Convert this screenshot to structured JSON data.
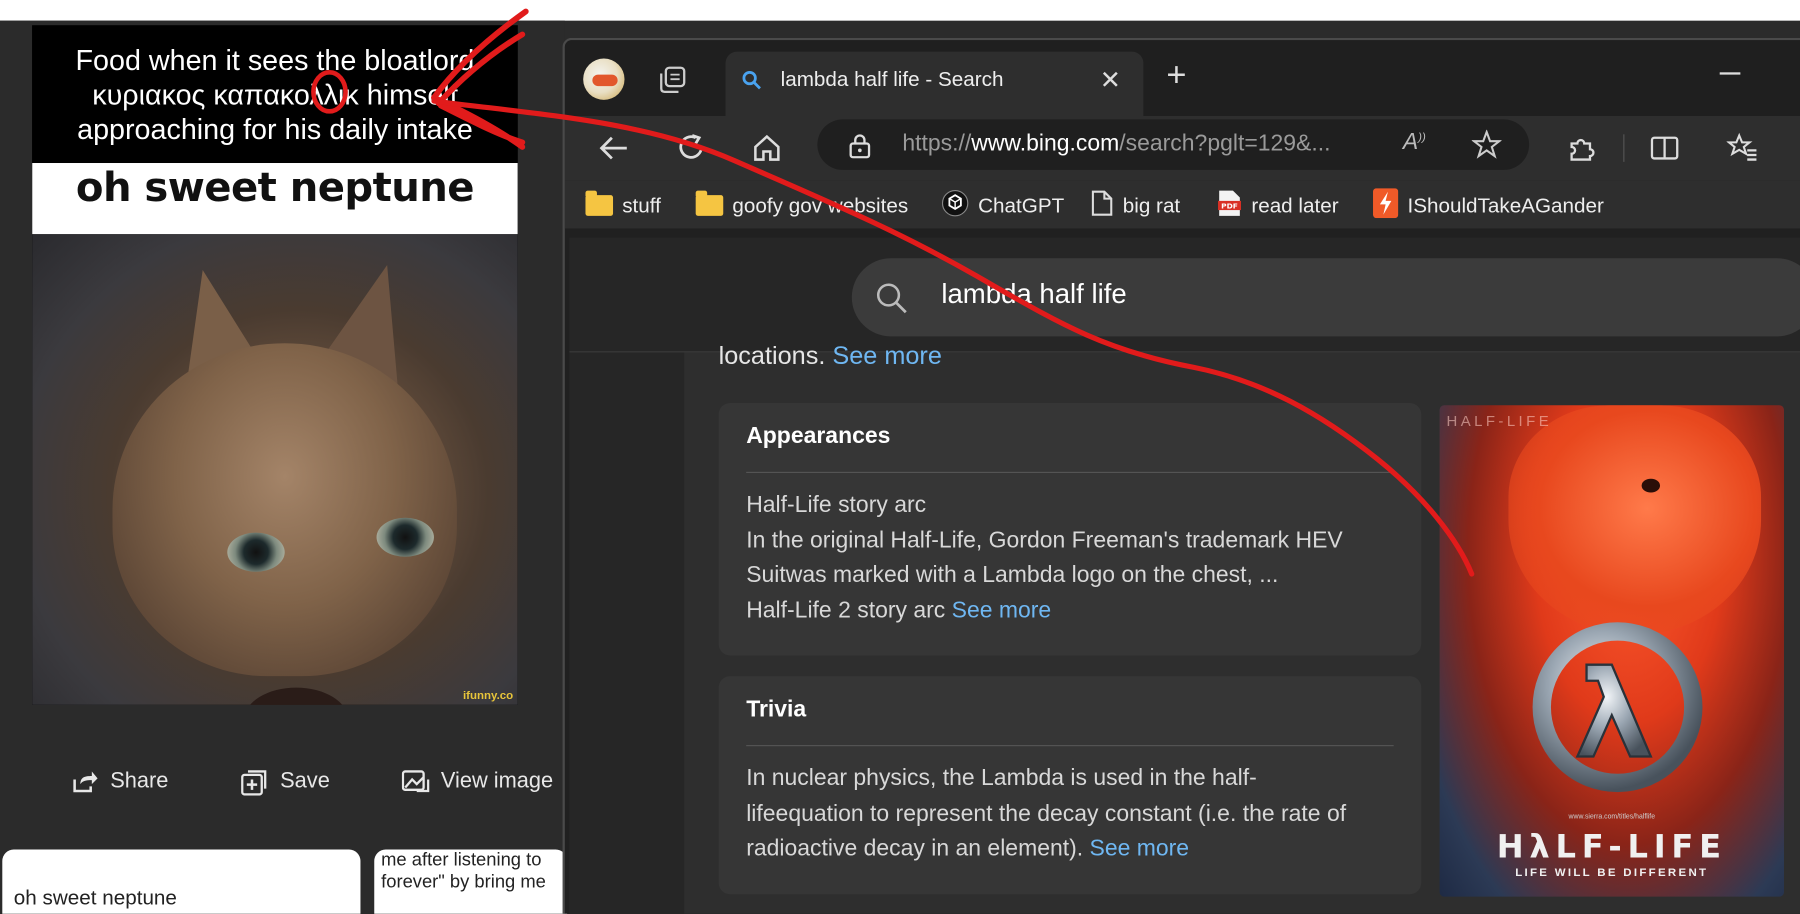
{
  "viewer": {
    "meme": {
      "caption_lines": [
        "Food when it sees the bloatlord",
        "κυριακος καπακολλικ himself",
        "approaching for his daily intake"
      ],
      "title": "oh sweet neptune",
      "watermark": "ifunny.co"
    },
    "actions": {
      "share": "Share",
      "save": "Save",
      "view_image": "View image"
    },
    "related": [
      {
        "text": "oh sweet neptune"
      },
      {
        "text_lines": [
          "me after listening to",
          "forever\" by bring me"
        ]
      }
    ]
  },
  "browser": {
    "tab": {
      "title": "lambda half life - Search"
    },
    "address": {
      "prefix": "https://",
      "domain": "www.bing.com",
      "path": "/search?pglt=129&..."
    },
    "favorites": [
      {
        "label": "stuff",
        "icon": "folder-icon"
      },
      {
        "label": "goofy gov websites",
        "icon": "folder-icon"
      },
      {
        "label": "ChatGPT",
        "icon": "chatgpt-icon"
      },
      {
        "label": "big rat",
        "icon": "page-icon"
      },
      {
        "label": "read later",
        "icon": "pdf-icon"
      },
      {
        "label": "IShouldTakeAGander",
        "icon": "bolt-icon"
      }
    ]
  },
  "bing": {
    "query": "lambda half life",
    "locations_text": "locations.",
    "see_more": "See more",
    "appearances": {
      "heading": "Appearances",
      "lines": [
        "Half-Life story arc",
        "In the original Half-Life, Gordon Freeman's trademark HEV",
        "Suitwas marked with a Lambda logo on the chest, ...",
        "Half-Life 2 story arc"
      ]
    },
    "trivia": {
      "heading": "Trivia",
      "lines": [
        "In nuclear physics, the Lambda is used in the half-",
        "lifeequation to represent the decay constant (i.e. the rate of",
        "radioactive decay in an element)."
      ]
    },
    "poster": {
      "top_text": "HALF-LIFE",
      "title": "HλLF-LIFE",
      "tagline": "LIFE WILL BE DIFFERENT",
      "url": "www.sierra.com/titles/halflife"
    }
  },
  "colors": {
    "annotation": "#e11b1b",
    "link": "#6fb7f2",
    "folder": "#f5c542"
  }
}
